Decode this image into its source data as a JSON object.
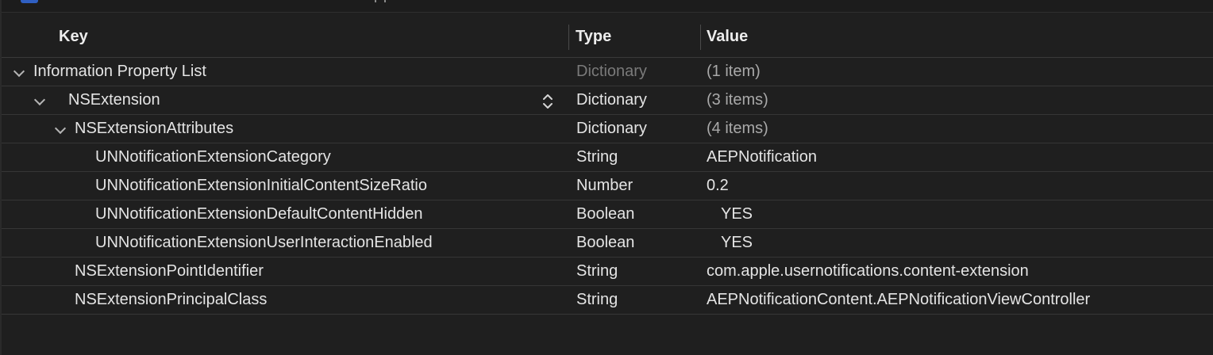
{
  "columns": {
    "key": "Key",
    "type": "Type",
    "value": "Value"
  },
  "rows": [
    {
      "key": "Information Property List",
      "type": "Dictionary",
      "value": "(1 item)"
    },
    {
      "key": "NSExtension",
      "type": "Dictionary",
      "value": "(3 items)"
    },
    {
      "key": "NSExtensionAttributes",
      "type": "Dictionary",
      "value": "(4 items)"
    },
    {
      "key": "UNNotificationExtensionCategory",
      "type": "String",
      "value": "AEPNotification"
    },
    {
      "key": "UNNotificationExtensionInitialContentSizeRatio",
      "type": "Number",
      "value": "0.2"
    },
    {
      "key": "UNNotificationExtensionDefaultContentHidden",
      "type": "Boolean",
      "value": "YES"
    },
    {
      "key": "UNNotificationExtensionUserInteractionEnabled",
      "type": "Boolean",
      "value": "YES"
    },
    {
      "key": "NSExtensionPointIdentifier",
      "type": "String",
      "value": "com.apple.usernotifications.content-extension"
    },
    {
      "key": "NSExtensionPrincipalClass",
      "type": "String",
      "value": "AEPNotificationContent.AEPNotificationViewController"
    }
  ],
  "icons": {
    "disclosure": "chevron-down-icon",
    "key_popup": "up-down-chevron-icon"
  },
  "colors": {
    "background": "#1f1f1f",
    "text": "#e4e4e4",
    "muted": "#7a7a7a",
    "separator": "#363636"
  }
}
